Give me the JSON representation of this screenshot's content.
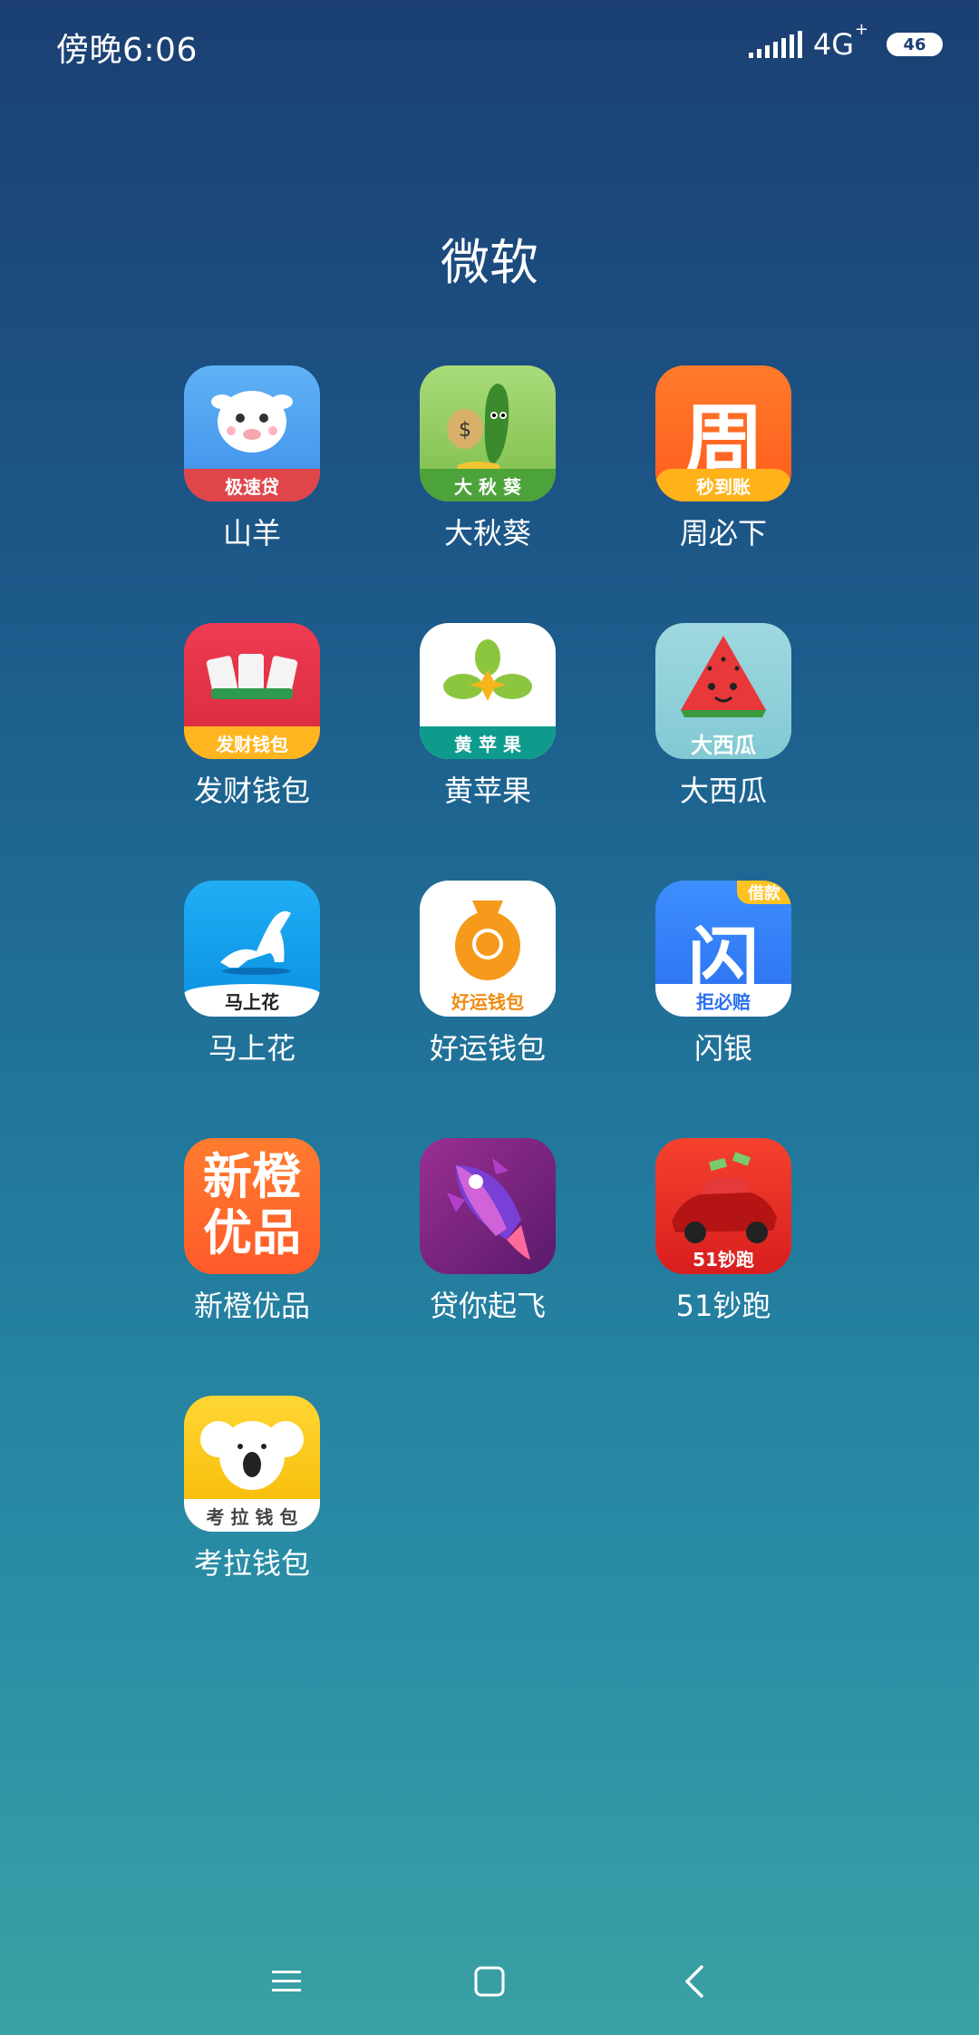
{
  "status": {
    "time": "傍晚6:06",
    "network": "4G",
    "network_plus": "+",
    "battery": "46"
  },
  "folder": {
    "title": "微软"
  },
  "apps": [
    {
      "label": "山羊",
      "badge": "极速贷",
      "colors": [
        "#5aa9f0",
        "#2d7fe0"
      ]
    },
    {
      "label": "大秋葵",
      "badge": "大 秋 葵",
      "colors": [
        "#9ed36a",
        "#6fb43e"
      ]
    },
    {
      "label": "周必下",
      "badge": "秒到账",
      "glyph": "周",
      "colors": [
        "#ff7a2a",
        "#ff5e1a"
      ]
    },
    {
      "label": "发财钱包",
      "badge": "发财钱包",
      "colors": [
        "#e8334a",
        "#d62838"
      ]
    },
    {
      "label": "黄苹果",
      "badge": "黄 苹 果",
      "colors": [
        "#ffffff",
        "#ffffff"
      ]
    },
    {
      "label": "大西瓜",
      "badge": "大西瓜",
      "colors": [
        "#9ad6de",
        "#7cc8d2"
      ]
    },
    {
      "label": "马上花",
      "badge": "马上花",
      "colors": [
        "#1aa7f2",
        "#0b8ee0"
      ]
    },
    {
      "label": "好运钱包",
      "badge": "好运钱包",
      "colors": [
        "#ffffff",
        "#ffffff"
      ]
    },
    {
      "label": "闪银",
      "badge": "拒必赔",
      "corner": "借款",
      "glyph": "闪",
      "colors": [
        "#3a8bff",
        "#2a6fee"
      ]
    },
    {
      "label": "新橙优品",
      "glyph_top": "新橙",
      "glyph_bottom": "优品",
      "colors": [
        "#ff7a2e",
        "#ff5a2a"
      ]
    },
    {
      "label": "贷你起飞",
      "colors": [
        "#8a2a8c",
        "#5e1b6e"
      ]
    },
    {
      "label": "51钞跑",
      "badge": "51钞跑",
      "colors": [
        "#f23a2a",
        "#d81e1e"
      ]
    },
    {
      "label": "考拉钱包",
      "badge": "考 拉 钱 包",
      "colors": [
        "#ffd32e",
        "#f5b800"
      ]
    }
  ]
}
